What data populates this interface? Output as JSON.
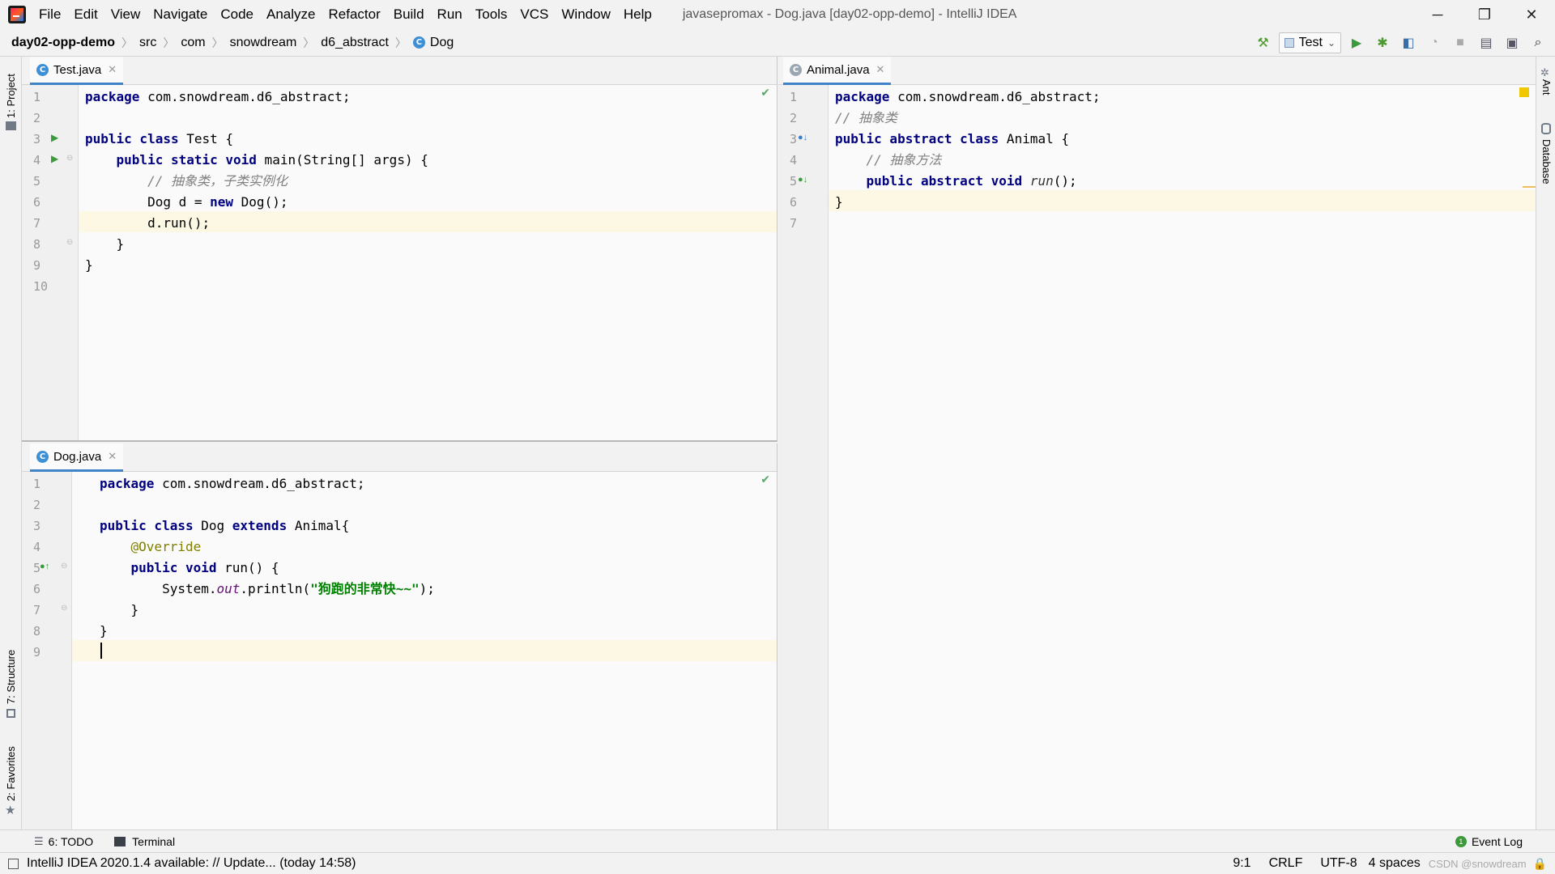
{
  "window": {
    "title": "javasepromax - Dog.java [day02-opp-demo] - IntelliJ IDEA",
    "menu": [
      "File",
      "Edit",
      "View",
      "Navigate",
      "Code",
      "Analyze",
      "Refactor",
      "Build",
      "Run",
      "Tools",
      "VCS",
      "Window",
      "Help"
    ],
    "controls": {
      "minimize": "─",
      "restore": "❐",
      "close": "✕"
    }
  },
  "navbar": {
    "breadcrumbs": [
      "day02-opp-demo",
      "src",
      "com",
      "snowdream",
      "d6_abstract",
      "Dog"
    ],
    "run_config": "Test"
  },
  "toolwindows": {
    "left_top": "1: Project",
    "left_structure": "7: Structure",
    "left_favorites": "2: Favorites",
    "right_ant": "Ant",
    "right_database": "Database"
  },
  "editors": {
    "test": {
      "tab": "Test.java",
      "lines": [
        "1",
        "2",
        "3",
        "4",
        "5",
        "6",
        "7",
        "8",
        "9",
        "10"
      ],
      "code": [
        [
          {
            "t": "package",
            "c": "kw"
          },
          {
            "t": " com.snowdream.d6_abstract;",
            "c": "pl"
          }
        ],
        [],
        [
          {
            "t": "public class",
            "c": "kw"
          },
          {
            "t": " Test {",
            "c": "pl"
          }
        ],
        [
          {
            "t": "    ",
            "c": "pl"
          },
          {
            "t": "public static void",
            "c": "kw"
          },
          {
            "t": " main(String[] args) {",
            "c": "pl"
          }
        ],
        [
          {
            "t": "        // 抽象类，子类实例化",
            "c": "cm"
          }
        ],
        [
          {
            "t": "        Dog d = ",
            "c": "pl"
          },
          {
            "t": "new",
            "c": "kw"
          },
          {
            "t": " Dog();",
            "c": "pl"
          }
        ],
        [
          {
            "t": "        d.run();",
            "c": "pl"
          }
        ],
        [
          {
            "t": "    }",
            "c": "pl"
          }
        ],
        [
          {
            "t": "}",
            "c": "pl"
          }
        ],
        []
      ]
    },
    "dog": {
      "tab": "Dog.java",
      "lines": [
        "1",
        "2",
        "3",
        "4",
        "5",
        "6",
        "7",
        "8",
        "9"
      ],
      "code": [
        [
          {
            "t": "package",
            "c": "kw"
          },
          {
            "t": " com.snowdream.d6_abstract;",
            "c": "pl"
          }
        ],
        [],
        [
          {
            "t": "public class",
            "c": "kw"
          },
          {
            "t": " Dog ",
            "c": "pl"
          },
          {
            "t": "extends",
            "c": "kw"
          },
          {
            "t": " Animal{",
            "c": "pl"
          }
        ],
        [
          {
            "t": "    @Override",
            "c": "an"
          }
        ],
        [
          {
            "t": "    ",
            "c": "pl"
          },
          {
            "t": "public void",
            "c": "kw"
          },
          {
            "t": " run() {",
            "c": "pl"
          }
        ],
        [
          {
            "t": "        System.",
            "c": "pl"
          },
          {
            "t": "out",
            "c": "fi"
          },
          {
            "t": ".println(",
            "c": "pl"
          },
          {
            "t": "\"狗跑的非常快~~\"",
            "c": "st"
          },
          {
            "t": ");",
            "c": "pl"
          }
        ],
        [
          {
            "t": "    }",
            "c": "pl"
          }
        ],
        [
          {
            "t": "}",
            "c": "pl"
          }
        ],
        []
      ]
    },
    "animal": {
      "tab": "Animal.java",
      "lines": [
        "1",
        "2",
        "3",
        "4",
        "5",
        "6",
        "7"
      ],
      "code": [
        [
          {
            "t": "package",
            "c": "kw"
          },
          {
            "t": " com.snowdream.d6_abstract;",
            "c": "pl"
          }
        ],
        [
          {
            "t": "// 抽象类",
            "c": "cm"
          }
        ],
        [
          {
            "t": "public abstract class",
            "c": "kw"
          },
          {
            "t": " Animal {",
            "c": "pl"
          }
        ],
        [
          {
            "t": "    // 抽象方法",
            "c": "cm"
          }
        ],
        [
          {
            "t": "    ",
            "c": "pl"
          },
          {
            "t": "public abstract void",
            "c": "kw"
          },
          {
            "t": " ",
            "c": "pl"
          },
          {
            "t": "run",
            "c": "mi"
          },
          {
            "t": "();",
            "c": "pl"
          }
        ],
        [
          {
            "t": "}",
            "c": "pl"
          }
        ],
        []
      ]
    }
  },
  "bottom_tools": {
    "todo": "6: TODO",
    "terminal": "Terminal",
    "event_log": "Event Log"
  },
  "status": {
    "message": "IntelliJ IDEA 2020.1.4 available: // Update... (today 14:58)",
    "position": "9:1",
    "line_sep": "CRLF",
    "encoding": "UTF-8",
    "indent": "4 spaces",
    "watermark": "CSDN @snowdream"
  },
  "colors": {
    "keyword": "#000080",
    "comment": "#808080",
    "string": "#008000",
    "annotation": "#808000",
    "accent": "#4083c9"
  }
}
